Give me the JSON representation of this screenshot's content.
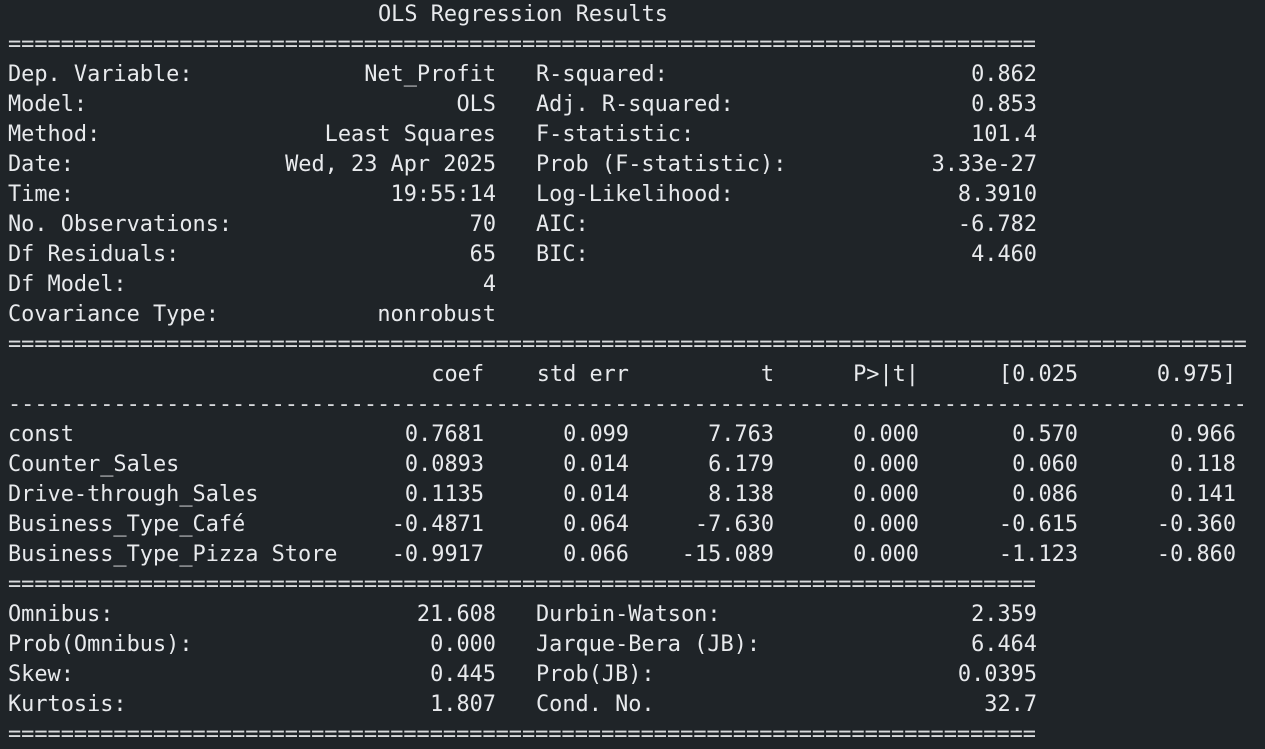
{
  "title": "OLS Regression Results",
  "rules": {
    "double_short": "==============================================================================",
    "double_long": "==============================================================================================",
    "single_long": "----------------------------------------------------------------------------------------------"
  },
  "summary_left": [
    {
      "label": "Dep. Variable:",
      "value": "Net_Profit"
    },
    {
      "label": "Model:",
      "value": "OLS"
    },
    {
      "label": "Method:",
      "value": "Least Squares"
    },
    {
      "label": "Date:",
      "value": "Wed, 23 Apr 2025"
    },
    {
      "label": "Time:",
      "value": "19:55:14"
    },
    {
      "label": "No. Observations:",
      "value": "70"
    },
    {
      "label": "Df Residuals:",
      "value": "65"
    },
    {
      "label": "Df Model:",
      "value": "4"
    },
    {
      "label": "Covariance Type:",
      "value": "nonrobust"
    }
  ],
  "summary_right": [
    {
      "label": "R-squared:",
      "value": "0.862"
    },
    {
      "label": "Adj. R-squared:",
      "value": "0.853"
    },
    {
      "label": "F-statistic:",
      "value": "101.4"
    },
    {
      "label": "Prob (F-statistic):",
      "value": "3.33e-27"
    },
    {
      "label": "Log-Likelihood:",
      "value": "8.3910"
    },
    {
      "label": "AIC:",
      "value": "-6.782"
    },
    {
      "label": "BIC:",
      "value": "4.460"
    }
  ],
  "coef_headers": [
    "coef",
    "std err",
    "t",
    "P>|t|",
    "[0.025",
    "0.975]"
  ],
  "coef_rows": [
    {
      "name": "const",
      "values": [
        "0.7681",
        "0.099",
        "7.763",
        "0.000",
        "0.570",
        "0.966"
      ]
    },
    {
      "name": "Counter_Sales",
      "values": [
        "0.0893",
        "0.014",
        "6.179",
        "0.000",
        "0.060",
        "0.118"
      ]
    },
    {
      "name": "Drive-through_Sales",
      "values": [
        "0.1135",
        "0.014",
        "8.138",
        "0.000",
        "0.086",
        "0.141"
      ]
    },
    {
      "name": "Business_Type_Café",
      "values": [
        "-0.4871",
        "0.064",
        "-7.630",
        "0.000",
        "-0.615",
        "-0.360"
      ]
    },
    {
      "name": "Business_Type_Pizza Store",
      "values": [
        "-0.9917",
        "0.066",
        "-15.089",
        "0.000",
        "-1.123",
        "-0.860"
      ]
    }
  ],
  "diag_left": [
    {
      "label": "Omnibus:",
      "value": "21.608"
    },
    {
      "label": "Prob(Omnibus):",
      "value": "0.000"
    },
    {
      "label": "Skew:",
      "value": "0.445"
    },
    {
      "label": "Kurtosis:",
      "value": "1.807"
    }
  ],
  "diag_right": [
    {
      "label": "Durbin-Watson:",
      "value": "2.359"
    },
    {
      "label": "Jarque-Bera (JB):",
      "value": "6.464"
    },
    {
      "label": "Prob(JB):",
      "value": "0.0395"
    },
    {
      "label": "Cond. No.",
      "value": "32.7"
    }
  ]
}
